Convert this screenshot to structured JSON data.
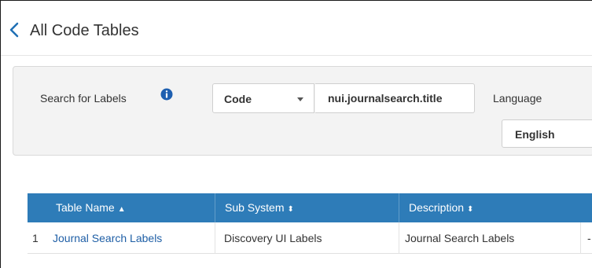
{
  "header": {
    "title": "All Code Tables"
  },
  "search": {
    "label": "Search for Labels",
    "field_selected": "Code",
    "query": "nui.journalsearch.title",
    "language_label": "Language",
    "language_selected": "English"
  },
  "table": {
    "columns": [
      {
        "label": "Table Name",
        "sort": "▲"
      },
      {
        "label": "Sub System",
        "sort": "⬍"
      },
      {
        "label": "Description",
        "sort": "⬍"
      }
    ],
    "rows": [
      {
        "index": "1",
        "table_name": "Journal Search Labels",
        "sub_system": "Discovery UI Labels",
        "description": "Journal Search Labels",
        "extra": "-"
      }
    ]
  },
  "colors": {
    "header_bg": "#2e7cb8",
    "link": "#1f5fa6",
    "info_icon": "#1e5fb0",
    "back_arrow": "#1f6fb4"
  }
}
